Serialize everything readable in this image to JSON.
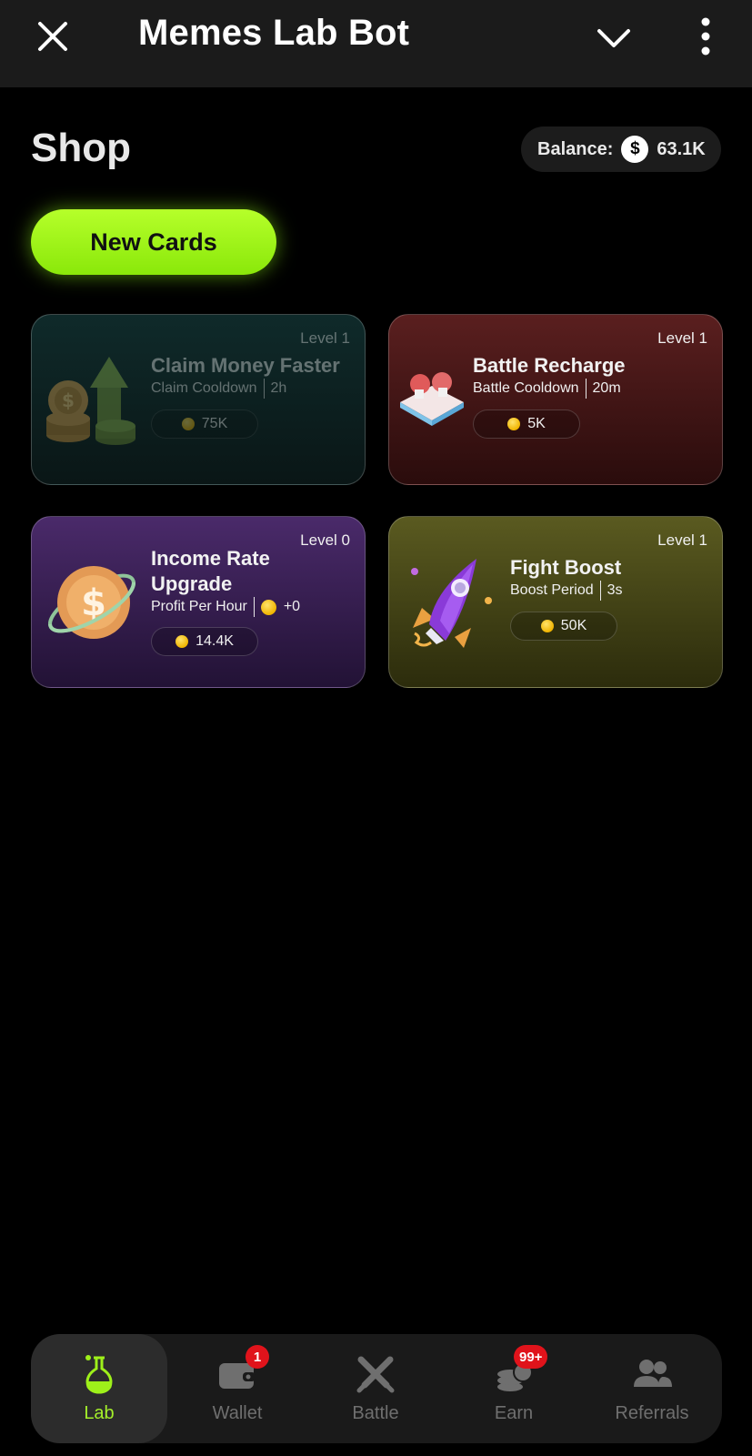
{
  "topbar": {
    "title": "Memes Lab Bot",
    "close_icon": "close-icon",
    "dropdown_icon": "chevron-down-icon",
    "more_icon": "more-vertical-icon"
  },
  "header": {
    "title": "Shop",
    "balance_label": "Balance:",
    "balance_currency_icon": "$",
    "balance_value": "63.1K"
  },
  "tabs": [
    {
      "label": "New Cards",
      "active": true
    }
  ],
  "cards": [
    {
      "level": "Level 1",
      "name": "Claim Money Faster",
      "meta_label": "Claim Cooldown",
      "meta_value": "2h",
      "price": "75K",
      "art": "money-stack-arrow-icon",
      "disabled": true
    },
    {
      "level": "Level 1",
      "name": "Battle Recharge",
      "meta_label": "Battle Cooldown",
      "meta_value": "20m",
      "price": "5K",
      "art": "boxing-ring-icon"
    },
    {
      "level": "Level 0",
      "name_line1": "Income Rate",
      "name_line2": "Upgrade",
      "meta_label": "Profit Per Hour",
      "meta_value": "+0",
      "price": "14.4K",
      "art": "dollar-coin-orbit-icon"
    },
    {
      "level": "Level 1",
      "name": "Fight Boost",
      "meta_label": "Boost Period",
      "meta_value": "3s",
      "price": "50K",
      "art": "rocket-icon"
    }
  ],
  "nav": [
    {
      "label": "Lab",
      "icon": "flask-icon",
      "active": true
    },
    {
      "label": "Wallet",
      "icon": "wallet-icon",
      "badge": "1"
    },
    {
      "label": "Battle",
      "icon": "crossed-swords-icon"
    },
    {
      "label": "Earn",
      "icon": "coins-stack-icon",
      "badge": "99+"
    },
    {
      "label": "Referrals",
      "icon": "users-icon"
    }
  ],
  "colors": {
    "accent": "#9ef01a",
    "background": "#000000",
    "topbar": "#1b1b1b",
    "badge": "#e0131b"
  }
}
